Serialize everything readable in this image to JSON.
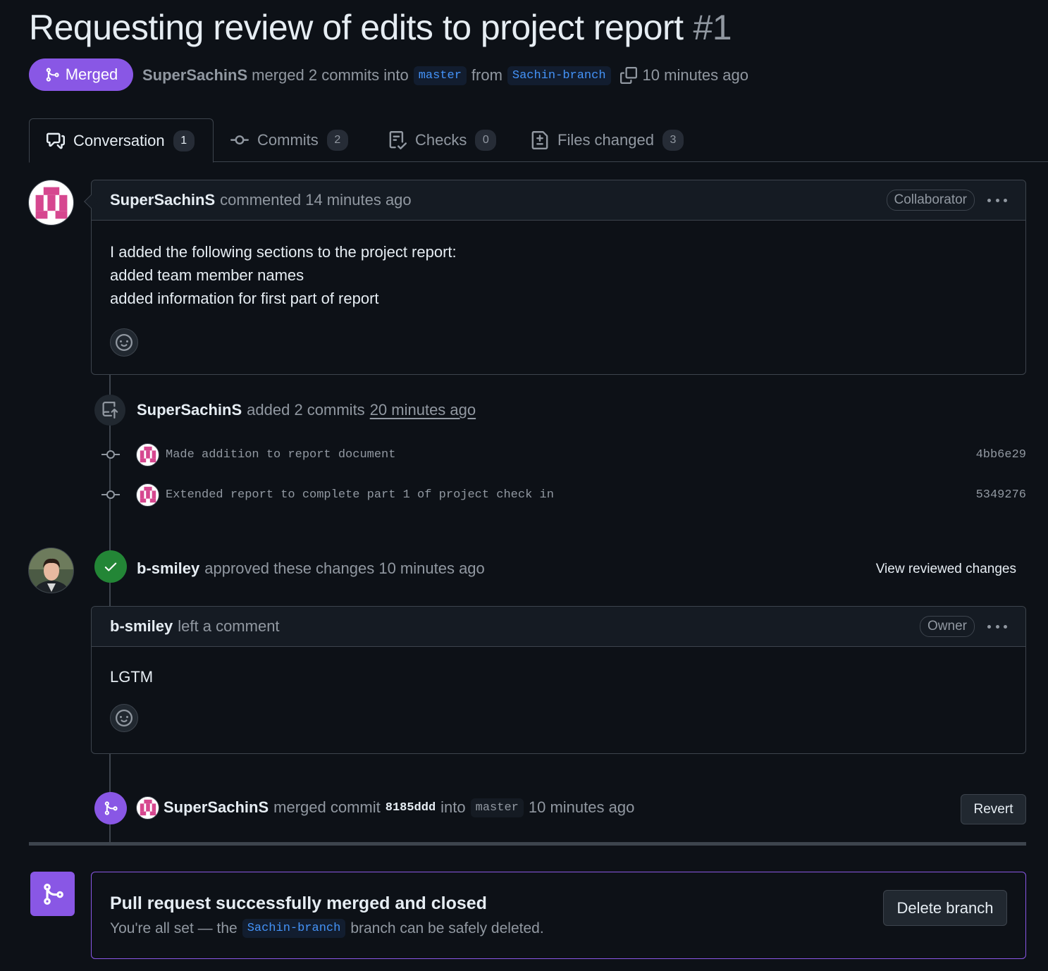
{
  "pr": {
    "title": "Requesting review of edits to project report",
    "number": "#1",
    "state": "Merged",
    "author": "SuperSachinS",
    "merge_text": "merged 2 commits into",
    "base_branch": "master",
    "from_text": "from",
    "head_branch": "Sachin-branch",
    "time": "10 minutes ago"
  },
  "tabs": [
    {
      "label": "Conversation",
      "count": "1",
      "icon": "comment-discussion-icon"
    },
    {
      "label": "Commits",
      "count": "2",
      "icon": "git-commit-icon"
    },
    {
      "label": "Checks",
      "count": "0",
      "icon": "checklist-icon"
    },
    {
      "label": "Files changed",
      "count": "3",
      "icon": "file-diff-icon"
    }
  ],
  "comment1": {
    "author": "SuperSachinS",
    "action": "commented 14 minutes ago",
    "role": "Collaborator",
    "lines": [
      "I added the following sections to the project report:",
      "added team member names",
      "added information for first part of report"
    ]
  },
  "commits_event": {
    "author": "SuperSachinS",
    "action": "added 2 commits",
    "time": "20 minutes ago",
    "commits": [
      {
        "message": "Made addition to report document",
        "sha": "4bb6e29"
      },
      {
        "message": "Extended report to complete part 1 of project check in",
        "sha": "5349276"
      }
    ]
  },
  "review": {
    "author": "b-smiley",
    "action": "approved these changes 10 minutes ago",
    "link": "View reviewed changes",
    "comment_author": "b-smiley",
    "comment_action": "left a comment",
    "role": "Owner",
    "body": "LGTM"
  },
  "merge_event": {
    "author": "SuperSachinS",
    "action": "merged commit",
    "sha": "8185ddd",
    "into": "into",
    "branch": "master",
    "time": "10 minutes ago",
    "revert_label": "Revert"
  },
  "merged_box": {
    "title": "Pull request successfully merged and closed",
    "desc_before": "You're all set — the",
    "branch": "Sachin-branch",
    "desc_after": "branch can be safely deleted.",
    "delete_label": "Delete branch"
  },
  "colors": {
    "merged": "#8957e5",
    "approved": "#238636",
    "link": "#4493f8",
    "bg": "#0d1117"
  }
}
